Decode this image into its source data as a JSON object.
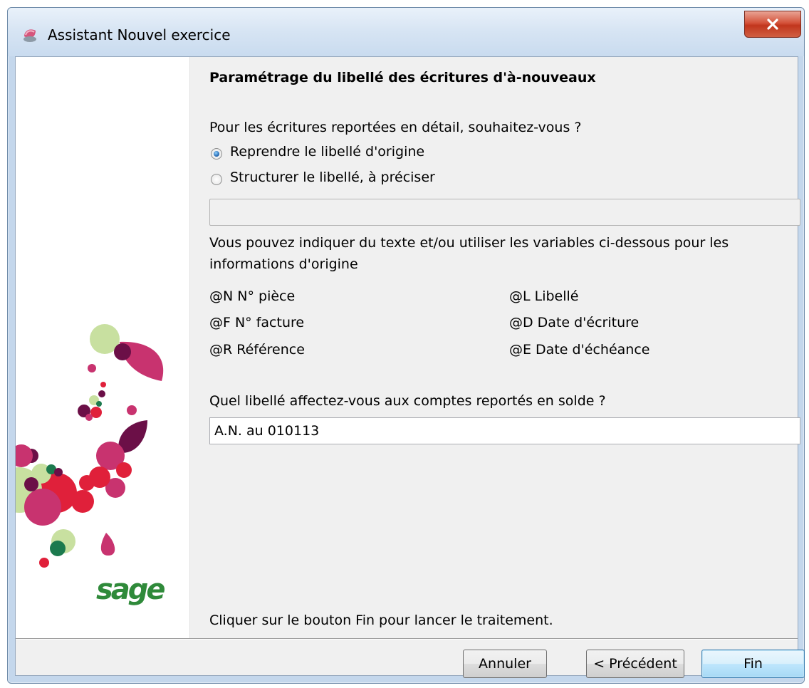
{
  "window": {
    "title": "Assistant Nouvel exercice",
    "close_icon": "close-icon"
  },
  "page": {
    "heading": "Paramétrage du libellé des écritures d'à-nouveaux",
    "question1": "Pour les écritures reportées en détail, souhaitez-vous ?",
    "options": [
      {
        "label": "Reprendre le libellé d'origine",
        "checked": true
      },
      {
        "label": "Structurer le libellé, à préciser",
        "checked": false
      }
    ],
    "structure_value": "",
    "help_line1": "Vous pouvez indiquer du texte et/ou utiliser les variables ci-dessous pour les",
    "help_line2": "informations d'origine",
    "variables_left": [
      "@N N° pièce",
      "@F N° facture",
      "@R Référence"
    ],
    "variables_right": [
      "@L Libellé",
      "@D Date d'écriture",
      "@E Date d'échéance"
    ],
    "question2": "Quel libellé affectez-vous aux comptes reportés en solde ?",
    "balance_label_value": "A.N. au 010113",
    "footer_hint": "Cliquer sur le bouton Fin pour lancer le traitement."
  },
  "side_panel": {
    "logo_text": "sage"
  },
  "buttons": {
    "cancel": "Annuler",
    "previous": "< Précédent",
    "finish": "Fin"
  },
  "colors": {
    "accent_default_button": "#3c7fb1",
    "close_button": "#c1361d",
    "logo_green": "#2f8a3a",
    "petal_magenta": "#c8336f",
    "petal_red": "#e0203a",
    "petal_plum": "#6b0f47",
    "petal_lightgreen": "#c8e0a0"
  }
}
